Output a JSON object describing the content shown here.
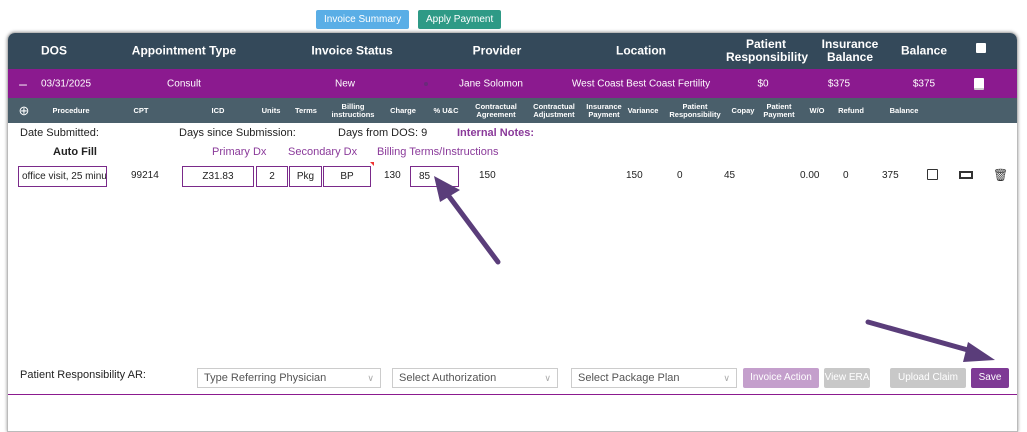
{
  "top_buttons": {
    "invoice_summary": "Invoice Summary",
    "apply_payment": "Apply Payment"
  },
  "header": {
    "dos": "DOS",
    "appointment_type": "Appointment Type",
    "invoice_status": "Invoice Status",
    "provider": "Provider",
    "location": "Location",
    "patient_responsibility": "Patient Responsibility",
    "insurance_balance": "Insurance Balance",
    "balance": "Balance"
  },
  "invoice": {
    "dos": "03/31/2025",
    "appointment_type": "Consult",
    "status": "New",
    "provider": "Jane Solomon",
    "location": "West Coast Best Coast Fertility",
    "patient_responsibility": "$0",
    "insurance_balance": "$375",
    "balance": "$375"
  },
  "sub_header": [
    "Procedure",
    "CPT",
    "ICD",
    "Units",
    "Terms",
    "Billing instructions",
    "Charge",
    "% U&C",
    "Contractual Agreement",
    "Contractual Adjustment",
    "Insurance Payment",
    "Variance",
    "Patient Responsibility",
    "Copay",
    "Patient Payment",
    "W/O",
    "Refund",
    "Balance"
  ],
  "info": {
    "date_submitted": "Date Submitted:",
    "days_since": "Days since Submission:",
    "days_from_dos": "Days from DOS: 9",
    "internal_notes": "Internal Notes:",
    "auto_fill": "Auto Fill",
    "primary_dx": "Primary Dx",
    "secondary_dx": "Secondary Dx",
    "billing_terms": "Billing Terms/Instructions"
  },
  "line": {
    "procedure": "office visit, 25 minu",
    "cpt": "99214",
    "icd": "Z31.83",
    "units": "2",
    "terms": "Pkg",
    "billing": "BP",
    "charge": "130",
    "uc": "85",
    "contractual_agreement": "150",
    "insurance_payment": "150",
    "variance": "0",
    "patient_responsibility": "45",
    "wo": "0.00",
    "refund": "0",
    "balance": "375"
  },
  "footer": {
    "ar_label": "Patient Responsibility AR:",
    "referring": "Type Referring Physician",
    "authorization": "Select Authorization",
    "package": "Select Package Plan",
    "invoice_action": "Invoice Action",
    "view_era": "View ERA",
    "upload_claim": "Upload Claim",
    "save": "Save"
  },
  "colors": {
    "purple": "#8b1a8f",
    "header": "#34495a",
    "subheader": "#4a5f6b",
    "arrow": "#5a3d7a"
  }
}
